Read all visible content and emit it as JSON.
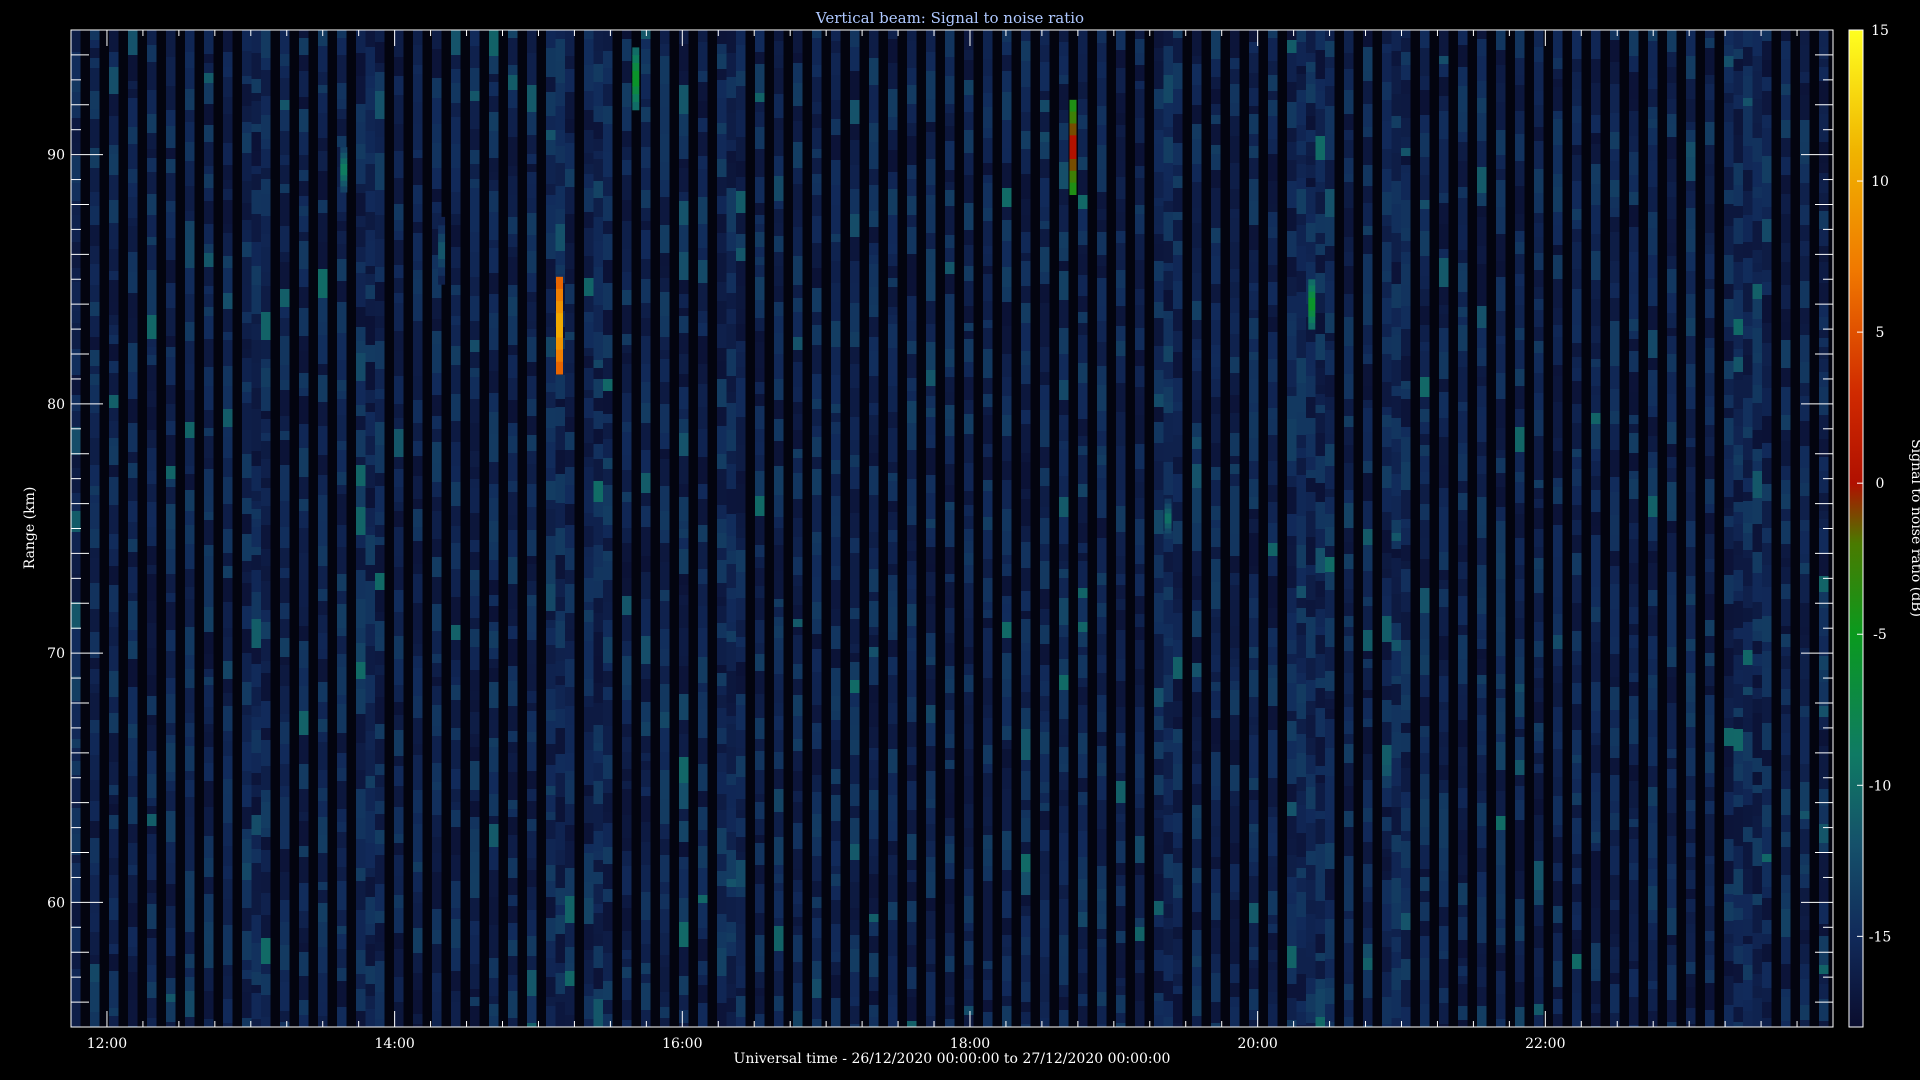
{
  "chart_data": {
    "type": "heatmap",
    "title": "Vertical beam: Signal to noise ratio",
    "xlabel": "Universal time - 26/12/2020 00:00:00 to 27/12/2020 00:00:00",
    "ylabel": "Range (km)",
    "colorbar_label": "Signal to noise ratio (dB)",
    "x_unit": "hours UT",
    "xlim": [
      11.75,
      24.0
    ],
    "ylim": [
      55.0,
      95.0
    ],
    "x_ticks": [
      {
        "value": 12,
        "label": "12:00"
      },
      {
        "value": 14,
        "label": "14:00"
      },
      {
        "value": 16,
        "label": "16:00"
      },
      {
        "value": 18,
        "label": "18:00"
      },
      {
        "value": 20,
        "label": "20:00"
      },
      {
        "value": 22,
        "label": "22:00"
      }
    ],
    "y_ticks": [
      {
        "value": 60,
        "label": "60"
      },
      {
        "value": 70,
        "label": "70"
      },
      {
        "value": 80,
        "label": "80"
      },
      {
        "value": 90,
        "label": "90"
      }
    ],
    "colorbar_range": [
      -18,
      15
    ],
    "colorbar_ticks": [
      {
        "value": 15,
        "label": "15"
      },
      {
        "value": 10,
        "label": "10"
      },
      {
        "value": 5,
        "label": "5"
      },
      {
        "value": 0,
        "label": "0"
      },
      {
        "value": -5,
        "label": "-5"
      },
      {
        "value": -10,
        "label": "-10"
      },
      {
        "value": -15,
        "label": "-15"
      }
    ],
    "colormap": [
      {
        "value": -18,
        "color": "#0a0d2e"
      },
      {
        "value": -15,
        "color": "#112a5a"
      },
      {
        "value": -12,
        "color": "#15506a"
      },
      {
        "value": -9,
        "color": "#0f7a64"
      },
      {
        "value": -5,
        "color": "#0a9a1e"
      },
      {
        "value": -2,
        "color": "#4a7a00"
      },
      {
        "value": 0,
        "color": "#b01000"
      },
      {
        "value": 3,
        "color": "#d02a00"
      },
      {
        "value": 7,
        "color": "#f07800"
      },
      {
        "value": 11,
        "color": "#f0b400"
      },
      {
        "value": 15,
        "color": "#ffff20"
      }
    ],
    "background_snr_db": -15.5,
    "events": [
      {
        "time": 13.65,
        "range_min": 88.5,
        "range_max": 90.3,
        "peak_snr_db": -8
      },
      {
        "time": 14.33,
        "range_min": 84.8,
        "range_max": 87.5,
        "peak_snr_db": -11
      },
      {
        "time": 15.15,
        "range_min": 81.2,
        "range_max": 85.1,
        "peak_snr_db": 11
      },
      {
        "time": 15.68,
        "range_min": 91.8,
        "range_max": 94.3,
        "peak_snr_db": -5
      },
      {
        "time": 18.72,
        "range_min": 88.4,
        "range_max": 92.2,
        "peak_snr_db": 1
      },
      {
        "time": 19.38,
        "range_min": 74.6,
        "range_max": 76.2,
        "peak_snr_db": -9
      },
      {
        "time": 20.38,
        "range_min": 83.0,
        "range_max": 85.0,
        "peak_snr_db": -5
      }
    ]
  }
}
